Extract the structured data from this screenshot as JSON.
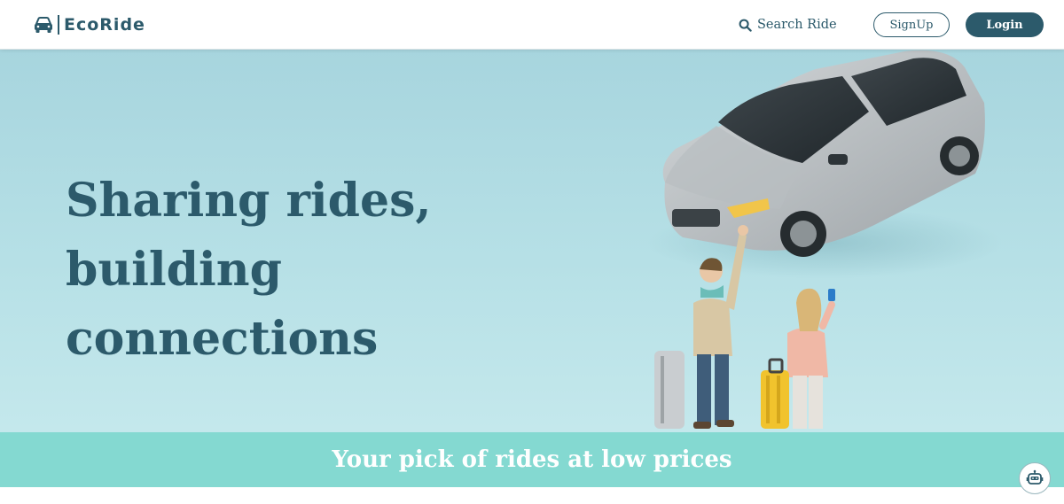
{
  "brand": {
    "name": "EcoRide",
    "logo_icon": "car-icon"
  },
  "nav": {
    "search_label": "Search Ride",
    "search_icon": "search-icon",
    "signup_label": "SignUp",
    "login_label": "Login"
  },
  "hero": {
    "title_lines": [
      "Sharing rides,",
      "building",
      "connections"
    ],
    "illustration": "car-and-travelers-illustration"
  },
  "banner": {
    "text": "Your pick of rides at low prices"
  },
  "assistant": {
    "icon": "robot-icon"
  },
  "colors": {
    "primary": "#2c5a6b",
    "hero_bg": "#b6e0e6",
    "banner_bg": "#84d9d1",
    "white": "#ffffff"
  }
}
